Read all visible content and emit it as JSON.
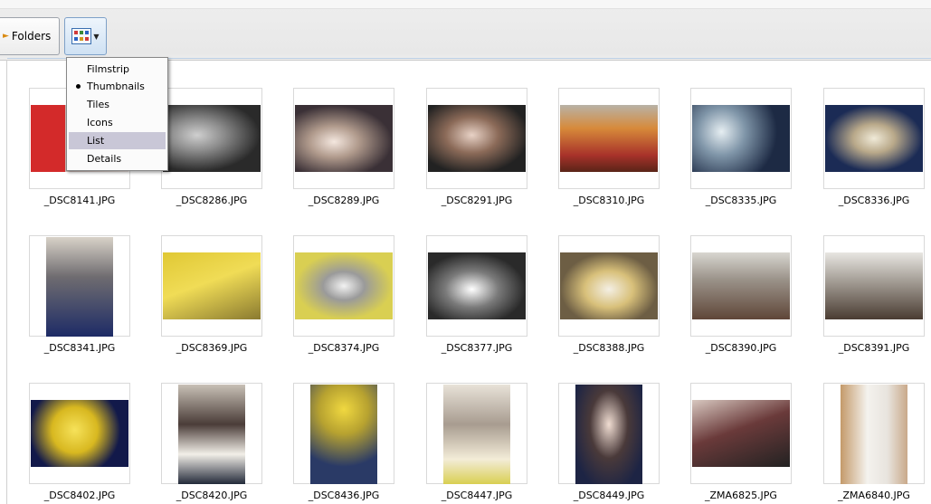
{
  "toolbar": {
    "folders_label": "Folders",
    "folders_icon": "arrow-icon",
    "views_icon": "thumbnails-view-icon"
  },
  "view_menu": {
    "items": [
      {
        "label": "Filmstrip",
        "selected": false
      },
      {
        "label": "Thumbnails",
        "selected": true
      },
      {
        "label": "Tiles",
        "selected": false
      },
      {
        "label": "Icons",
        "selected": false
      },
      {
        "label": "List",
        "selected": false,
        "hovered": true
      },
      {
        "label": "Details",
        "selected": false
      }
    ],
    "hover_color": "#c9c7d7"
  },
  "files": [
    {
      "name": "_DSC8141.JPG"
    },
    {
      "name": "_DSC8286.JPG"
    },
    {
      "name": "_DSC8289.JPG"
    },
    {
      "name": "_DSC8291.JPG"
    },
    {
      "name": "_DSC8310.JPG"
    },
    {
      "name": "_DSC8335.JPG"
    },
    {
      "name": "_DSC8336.JPG"
    },
    {
      "name": "_DSC8341.JPG"
    },
    {
      "name": "_DSC8369.JPG"
    },
    {
      "name": "_DSC8374.JPG"
    },
    {
      "name": "_DSC8377.JPG"
    },
    {
      "name": "_DSC8388.JPG"
    },
    {
      "name": "_DSC8390.JPG"
    },
    {
      "name": "_DSC8391.JPG"
    },
    {
      "name": "_DSC8402.JPG"
    },
    {
      "name": "_DSC8420.JPG"
    },
    {
      "name": "_DSC8436.JPG"
    },
    {
      "name": "_DSC8447.JPG"
    },
    {
      "name": "_DSC8449.JPG"
    },
    {
      "name": "_ZMA6825.JPG"
    },
    {
      "name": "_ZMA6840.JPG"
    }
  ]
}
